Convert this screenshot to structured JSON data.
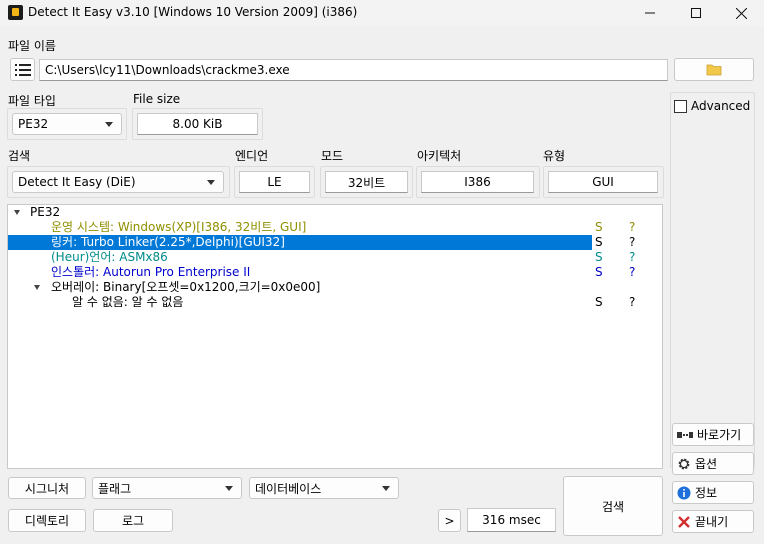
{
  "window": {
    "title": "Detect It Easy v3.10 [Windows 10 Version 2009] (i386)",
    "icon": "die-logo-icon"
  },
  "file": {
    "label": "파일 이름",
    "path": "C:\\Users\\lcy11\\Downloads\\crackme3.exe"
  },
  "file_type": {
    "label": "파일 타입",
    "value": "PE32"
  },
  "file_size": {
    "label": "File size",
    "value": "8.00 KiB"
  },
  "scan": {
    "label": "검색",
    "engine": "Detect It Easy (DiE)"
  },
  "endian": {
    "label": "엔디언",
    "value": "LE"
  },
  "mode": {
    "label": "모드",
    "value": "32비트"
  },
  "arch": {
    "label": "아키텍처",
    "value": "I386"
  },
  "type": {
    "label": "유형",
    "value": "GUI"
  },
  "advanced_label": "Advanced",
  "results": [
    {
      "text": "PE32",
      "s": "",
      "q": "",
      "color": "#000000"
    },
    {
      "text": "운영 시스템: Windows(XP)[I386, 32비트, GUI]",
      "s": "S",
      "q": "?",
      "color": "#8f8f00"
    },
    {
      "text": "링커: Turbo Linker(2.25*,Delphi)[GUI32]",
      "s": "S",
      "q": "?",
      "color": "#ffffff"
    },
    {
      "text": "(Heur)언어: ASMx86",
      "s": "S",
      "q": "?",
      "color": "#008b8b"
    },
    {
      "text": "인스톨러: Autorun Pro Enterprise II",
      "s": "S",
      "q": "?",
      "color": "#0000cc"
    },
    {
      "text": "오버레이: Binary[오프셋=0x1200,크기=0x0e00]",
      "s": "",
      "q": "",
      "color": "#000000"
    },
    {
      "text": "알 수 없음: 알 수 없음",
      "s": "S",
      "q": "?",
      "color": "#000000"
    }
  ],
  "bottom": {
    "signatures": "시그니처",
    "flags": "플래그",
    "database": "데이터베이스",
    "directory": "디렉토리",
    "log": "로그",
    "more": ">",
    "time": "316 msec",
    "scan": "검색"
  },
  "side": {
    "shortcut": "바로가기",
    "options": "옵션",
    "info": "정보",
    "exit": "끝내기"
  },
  "colors": {
    "selection": "#0078d7",
    "exit_icon": "#d32f2f",
    "info_icon": "#1e6fd9",
    "folder_icon": "#f2c84b"
  }
}
